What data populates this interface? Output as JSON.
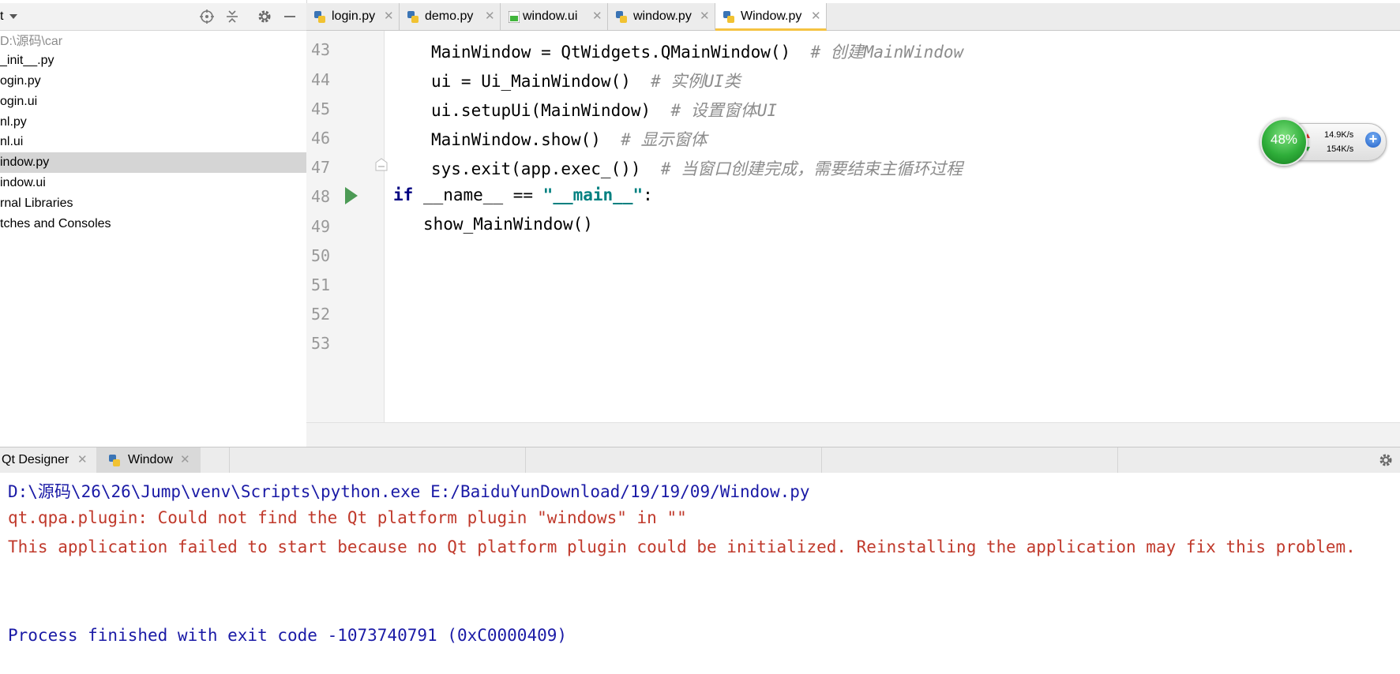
{
  "sidebar": {
    "title": "t",
    "items": [
      {
        "label": "D:\\源码\\car",
        "kind": "path"
      },
      {
        "label": "_init__.py"
      },
      {
        "label": "ogin.py"
      },
      {
        "label": "ogin.ui"
      },
      {
        "label": "nl.py"
      },
      {
        "label": "nl.ui"
      },
      {
        "label": "indow.py",
        "selected": true
      },
      {
        "label": "indow.ui"
      },
      {
        "label": "rnal Libraries"
      },
      {
        "label": "tches and Consoles"
      }
    ]
  },
  "editor_tabs": [
    {
      "label": "login.py"
    },
    {
      "label": "demo.py"
    },
    {
      "label": "window.ui"
    },
    {
      "label": "window.py"
    },
    {
      "label": "Window.py",
      "active": true
    }
  ],
  "editor": {
    "line_numbers": [
      "43",
      "44",
      "45",
      "46",
      "47",
      "48",
      "49",
      "50",
      "51",
      "52",
      "53"
    ],
    "lines": [
      {
        "code": "MainWindow = QtWidgets.QMainWindow()",
        "comment": "# 创建MainWindow"
      },
      {
        "code": "ui = Ui_MainWindow()",
        "comment": "# 实例UI类"
      },
      {
        "code": "ui.setupUi(MainWindow)",
        "comment": "# 设置窗体UI"
      },
      {
        "code": "MainWindow.show()",
        "comment": "# 显示窗体"
      },
      {
        "code": "sys.exit(app.exec_())",
        "comment": "# 当窗口创建完成，需要结束主循环过程"
      },
      {
        "keyword": "if",
        "code": " __name__ == ",
        "string": "\"__main__\"",
        "tail": ":"
      },
      {
        "code": "show_MainWindow()"
      }
    ]
  },
  "run_tabs": [
    {
      "label": "Qt Designer"
    },
    {
      "label": "Window",
      "active": true
    }
  ],
  "console": {
    "command": "D:\\源码\\26\\26\\Jump\\venv\\Scripts\\python.exe E:/BaiduYunDownload/19/19/09/Window.py",
    "error1": "qt.qpa.plugin: Could not find the Qt platform plugin \"windows\" in \"\"",
    "error2": "This application failed to start because no Qt platform plugin could be initialized. Reinstalling the application may fix this problem.",
    "exit": "Process finished with exit code -1073740791 (0xC0000409)",
    "colors": {
      "command": "#1a1aa6",
      "error": "#c0392b",
      "exit": "#1a1aa6"
    }
  },
  "net_widget": {
    "percent": "48%",
    "upload": "14.9K/s",
    "download": "154K/s",
    "plus": "+"
  },
  "icons": [
    "locate-icon",
    "collapse-icon",
    "gear-icon",
    "minimize-icon",
    "python-file-icon",
    "ui-file-icon",
    "close-icon",
    "run-icon",
    "fold-icon"
  ]
}
